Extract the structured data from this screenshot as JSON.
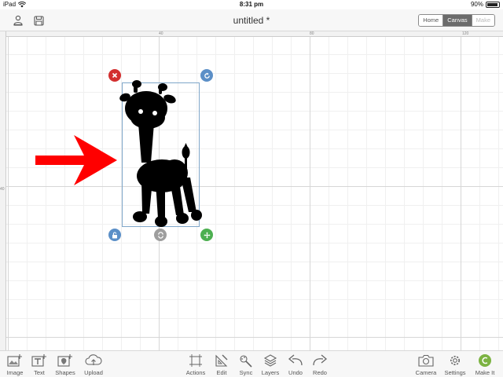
{
  "status_bar": {
    "device": "iPad",
    "time": "8:31 pm",
    "battery": "90%",
    "battery_level": 0.9
  },
  "header": {
    "title": "untitled *",
    "segments": [
      {
        "label": "Home",
        "state": "normal"
      },
      {
        "label": "Canvas",
        "state": "active"
      },
      {
        "label": "Make",
        "state": "disabled"
      }
    ]
  },
  "rulers": {
    "top_labels": [
      "40",
      "80",
      "120"
    ],
    "left_labels": [
      "40"
    ]
  },
  "canvas": {
    "arrow_color": "#ff0000",
    "selection_color": "#7fa6c9"
  },
  "toolbar": {
    "left": [
      {
        "label": "Image",
        "icon": "image-add-icon"
      },
      {
        "label": "Text",
        "icon": "text-add-icon"
      },
      {
        "label": "Shapes",
        "icon": "shapes-icon"
      },
      {
        "label": "Upload",
        "icon": "cloud-upload-icon"
      }
    ],
    "middle": [
      {
        "label": "Actions",
        "icon": "actions-icon"
      },
      {
        "label": "Edit",
        "icon": "edit-icon"
      },
      {
        "label": "Sync",
        "icon": "sync-icon"
      },
      {
        "label": "Layers",
        "icon": "layers-icon"
      },
      {
        "label": "Undo",
        "icon": "undo-icon"
      },
      {
        "label": "Redo",
        "icon": "redo-icon"
      }
    ],
    "right": [
      {
        "label": "Camera",
        "icon": "camera-icon"
      },
      {
        "label": "Settings",
        "icon": "gear-icon"
      },
      {
        "label": "Make It",
        "icon": "make-it-icon"
      }
    ]
  },
  "colors": {
    "make_it_green": "#7cb342",
    "handle_red": "#d32f2f",
    "handle_blue": "#5b8fc7",
    "handle_green": "#4caf50",
    "handle_gray": "#9e9e9e"
  }
}
